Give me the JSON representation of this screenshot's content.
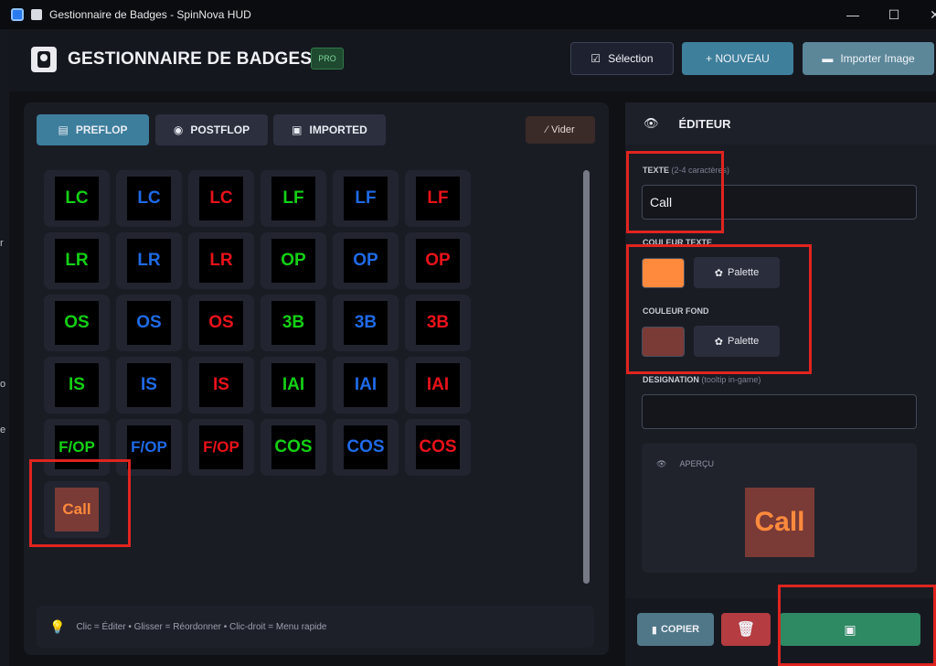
{
  "window": {
    "title": "Gestionnaire de Badges - SpinNova HUD",
    "controls": {
      "minimize": "—",
      "maximize": "☐",
      "close": "✕"
    }
  },
  "rail_letters": [
    "r",
    "o",
    "e"
  ],
  "header": {
    "title": "GESTIONNAIRE DE BADGES",
    "pro": "PRO",
    "selection_label": "Sélection",
    "nouveau_label": "+ NOUVEAU",
    "import_label": "Importer Image"
  },
  "tabs": {
    "preflop": "PREFLOP",
    "postflop": "POSTFLOP",
    "imported": "IMPORTED",
    "vider": "Vider"
  },
  "colors": {
    "green": "#14d014",
    "blue": "#1f6ae6",
    "red": "#e8121a",
    "call_text": "#ff8a3d",
    "call_bg": "#7a3a35"
  },
  "badges": [
    {
      "text": "LC",
      "color": "green"
    },
    {
      "text": "LC",
      "color": "blue"
    },
    {
      "text": "LC",
      "color": "red"
    },
    {
      "text": "LF",
      "color": "green"
    },
    {
      "text": "LF",
      "color": "blue"
    },
    {
      "text": "LF",
      "color": "red"
    },
    {
      "text": "LR",
      "color": "green"
    },
    {
      "text": "LR",
      "color": "blue"
    },
    {
      "text": "LR",
      "color": "red"
    },
    {
      "text": "OP",
      "color": "green"
    },
    {
      "text": "OP",
      "color": "blue"
    },
    {
      "text": "OP",
      "color": "red"
    },
    {
      "text": "OS",
      "color": "green"
    },
    {
      "text": "OS",
      "color": "blue"
    },
    {
      "text": "OS",
      "color": "red"
    },
    {
      "text": "3B",
      "color": "green"
    },
    {
      "text": "3B",
      "color": "blue"
    },
    {
      "text": "3B",
      "color": "red"
    },
    {
      "text": "IS",
      "color": "green"
    },
    {
      "text": "IS",
      "color": "blue"
    },
    {
      "text": "IS",
      "color": "red"
    },
    {
      "text": "IAI",
      "color": "green"
    },
    {
      "text": "IAI",
      "color": "blue"
    },
    {
      "text": "IAI",
      "color": "red"
    },
    {
      "text": "F/OP",
      "color": "green"
    },
    {
      "text": "F/OP",
      "color": "blue"
    },
    {
      "text": "F/OP",
      "color": "red"
    },
    {
      "text": "COS",
      "color": "green"
    },
    {
      "text": "COS",
      "color": "blue"
    },
    {
      "text": "COS",
      "color": "red"
    },
    {
      "text": "Call",
      "color": "call_text",
      "bg": "call_bg"
    }
  ],
  "hint": "Clic = Éditer  •  Glisser = Réordonner  •  Clic-droit = Menu rapide",
  "editor": {
    "title": "ÉDITEUR",
    "texte_label": "TEXTE",
    "texte_sub": "(2-4 caractères)",
    "texte_value": "Call",
    "couleur_texte_label": "COULEUR TEXTE",
    "couleur_fond_label": "COULEUR FOND",
    "palette_label": "Palette",
    "designation_label": "DESIGNATION",
    "designation_sub": "(tooltip in-game)",
    "designation_value": "",
    "apercu_label": "APERÇU",
    "preview_text": "Call",
    "copier_label": "COPIER"
  }
}
